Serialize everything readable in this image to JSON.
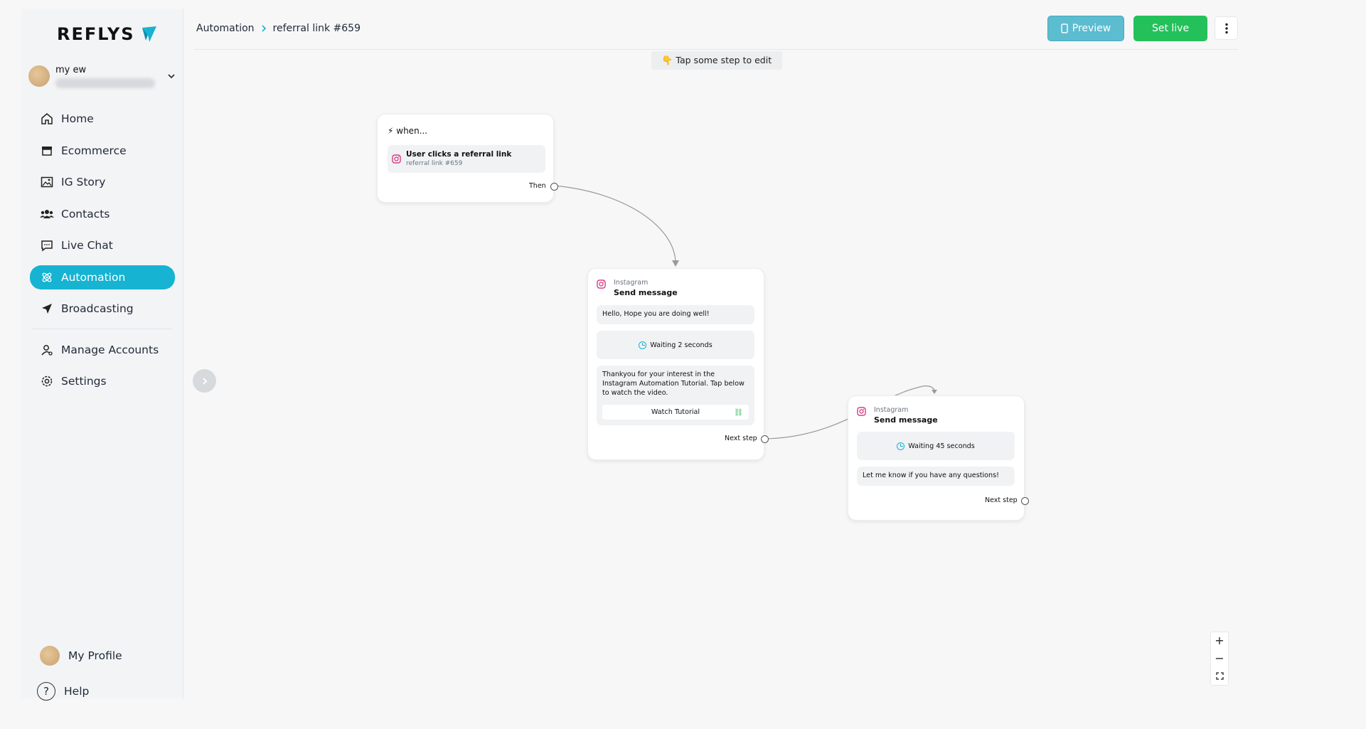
{
  "brand": {
    "name": "REFLYS"
  },
  "account": {
    "name": "my ew"
  },
  "sidebar": {
    "items": [
      {
        "label": "Home",
        "icon": "home-icon"
      },
      {
        "label": "Ecommerce",
        "icon": "store-icon"
      },
      {
        "label": "IG Story",
        "icon": "image-icon"
      },
      {
        "label": "Contacts",
        "icon": "users-icon"
      },
      {
        "label": "Live Chat",
        "icon": "chat-icon"
      },
      {
        "label": "Automation",
        "icon": "automation-icon",
        "active": true
      },
      {
        "label": "Broadcasting",
        "icon": "send-icon"
      }
    ],
    "secondary": [
      {
        "label": "Manage Accounts",
        "icon": "user-manage-icon"
      },
      {
        "label": "Settings",
        "icon": "gear-icon"
      }
    ],
    "bottom": [
      {
        "label": "My Profile"
      },
      {
        "label": "Help"
      }
    ]
  },
  "header": {
    "breadcrumb": [
      "Automation",
      "referral link #659"
    ],
    "preview_label": "Preview",
    "set_live_label": "Set live"
  },
  "hint": "👇 Tap some step to edit",
  "trigger": {
    "heading": "when...",
    "title": "User clicks a referral link",
    "subtitle": "referral link #659",
    "port_label": "Then"
  },
  "step1": {
    "platform": "Instagram",
    "title": "Send message",
    "message1": "Hello, Hope you are doing well!",
    "wait": "Waiting 2 seconds",
    "message2": "Thankyou for your interest in the Instagram Automation Tutorial. Tap below to watch the video.",
    "button": "Watch Tutorial",
    "port_label": "Next step"
  },
  "step2": {
    "platform": "Instagram",
    "title": "Send message",
    "wait": "Waiting 45 seconds",
    "message": "Let me know if you have any questions!",
    "port_label": "Next step"
  },
  "colors": {
    "accent": "#16b3d2",
    "live": "#24c15a",
    "preview": "#5cbcd0"
  }
}
